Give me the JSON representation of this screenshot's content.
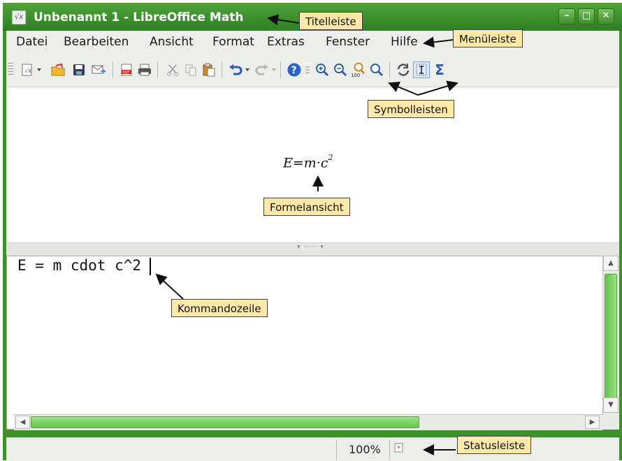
{
  "window": {
    "title": "Unbenannt 1 - LibreOffice Math",
    "app_icon": "math-app-icon",
    "controls": [
      "minimize-icon",
      "maximize-icon",
      "close-icon"
    ]
  },
  "menubar": {
    "items": [
      {
        "label": "Datei"
      },
      {
        "label": "Bearbeiten"
      },
      {
        "label": "Ansicht"
      },
      {
        "label": "Format"
      },
      {
        "label": "Extras"
      },
      {
        "label": "Fenster"
      },
      {
        "label": "Hilfe"
      }
    ]
  },
  "toolbar": {
    "icons": [
      "new-icon",
      "open-icon",
      "save-icon",
      "email-icon",
      "export-pdf-icon",
      "print-icon",
      "cut-icon",
      "copy-icon",
      "paste-icon",
      "undo-icon",
      "redo-icon",
      "help-icon",
      "zoom-in-icon",
      "zoom-out-icon",
      "zoom-100-icon",
      "show-all-icon",
      "update-icon",
      "formula-cursor-icon",
      "sum-icon"
    ]
  },
  "formula_view": {
    "formula_base": "E=m·c",
    "formula_exponent": "2"
  },
  "command_line": {
    "text": "E = m cdot c^2"
  },
  "statusbar": {
    "zoom": "100%",
    "doc_modified_icon": "document-modified-icon"
  },
  "annotations": {
    "titlebar": "Titelleiste",
    "menubar": "Menüleiste",
    "toolbars": "Symbolleisten",
    "formula_view": "Formelansicht",
    "command_line": "Kommandozeile",
    "statusbar": "Statusleiste"
  },
  "colors": {
    "window_frame": "#3f8f2a",
    "titlebar_text": "#ffffff",
    "scrollbar_thumb": "#66c24c",
    "callout_bg": "#ffe9a8"
  }
}
